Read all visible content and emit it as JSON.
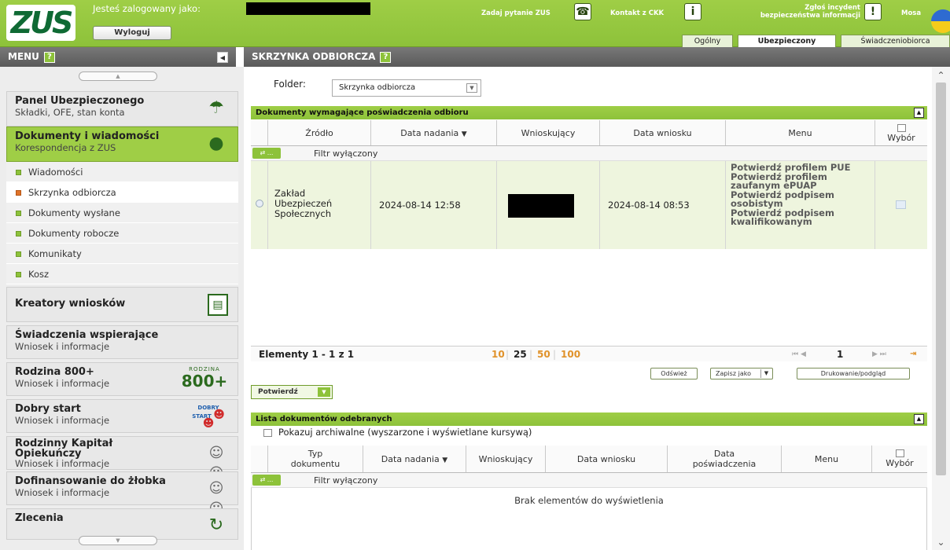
{
  "header": {
    "logo_text": "ZUS",
    "logged_in_label": "Jesteś zalogowany jako:",
    "logout_label": "Wyloguj",
    "ask_label": "Zadaj pytanie ZUS",
    "contact_label": "Kontakt z CKK",
    "incident_line1": "Zgłoś incydent",
    "incident_line2": "bezpieczeństwa informacji",
    "user_label": "Mosa",
    "tabs": [
      "Ogólny",
      "Ubezpieczony",
      "Świadczeniobiorca"
    ],
    "active_tab": "Ubezpieczony"
  },
  "menu": {
    "title": "MENU",
    "panels": [
      {
        "title": "Panel Ubezpieczonego",
        "subtitle": "Składki, OFE, stan konta"
      },
      {
        "title": "Dokumenty i wiadomości",
        "subtitle": "Korespondencja z ZUS"
      }
    ],
    "sub_items": [
      "Wiadomości",
      "Skrzynka odbiorcza",
      "Dokumenty wysłane",
      "Dokumenty robocze",
      "Komunikaty",
      "Kosz"
    ],
    "selected_sub": "Skrzynka odbiorcza",
    "panels2": [
      {
        "title": "Kreatory wniosków",
        "subtitle": ""
      },
      {
        "title": "Świadczenia wspierające",
        "subtitle": "Wniosek i informacje"
      },
      {
        "title": "Rodzina 800+",
        "subtitle": "Wniosek i informacje",
        "badge": "800+",
        "badge_small": "RODZINA"
      },
      {
        "title": "Dobry start",
        "subtitle": "Wniosek i informacje",
        "badge": "DOBRY START"
      },
      {
        "title": "Rodzinny Kapitał Opiekuńczy",
        "subtitle": "Wniosek i informacje"
      },
      {
        "title": "Dofinansowanie do żłobka",
        "subtitle": "Wniosek i informacje"
      },
      {
        "title": "Zlecenia",
        "subtitle": ""
      }
    ]
  },
  "content": {
    "title": "SKRZYNKA ODBIORCZA",
    "folder_label": "Folder:",
    "folder_value": "Skrzynka odbiorcza",
    "section1": {
      "title": "Dokumenty wymagające poświadczenia odbioru",
      "columns": [
        "Źródło",
        "Data nadania",
        "Wnioskujący",
        "Data wniosku",
        "Menu",
        "Wybór"
      ],
      "filter_label": "Filtr wyłączony",
      "filter_btn": "...",
      "row": {
        "source": "Zakład Ubezpieczeń Społecznych",
        "sent_date": "2024-08-14 12:58",
        "request_date": "2024-08-14 08:53",
        "menu_items": [
          "Potwierdź profilem PUE",
          "Potwierdź profilem zaufanym ePUAP",
          "Potwierdź podpisem osobistym",
          "Potwierdź podpisem kwalifikowanym"
        ]
      },
      "pager": {
        "elements": "Elementy 1 - 1 z 1",
        "sizes": [
          "10",
          "25",
          "50",
          "100"
        ],
        "current_size": "25",
        "page": "1"
      },
      "buttons": [
        "Odśwież",
        "Zapisz jako",
        "Drukowanie/podgląd"
      ],
      "confirm_label": "Potwierdź"
    },
    "section2": {
      "title": "Lista dokumentów odebranych",
      "archive_label": "Pokazuj archiwalne (wyszarzone i wyświetlane kursywą)",
      "columns": [
        "Typ dokumentu",
        "Data nadania",
        "Wnioskujący",
        "Data wniosku",
        "Data poświadczenia",
        "Menu",
        "Wybór"
      ],
      "filter_label": "Filtr wyłączony",
      "empty_text": "Brak elementów do wyświetlenia"
    }
  }
}
